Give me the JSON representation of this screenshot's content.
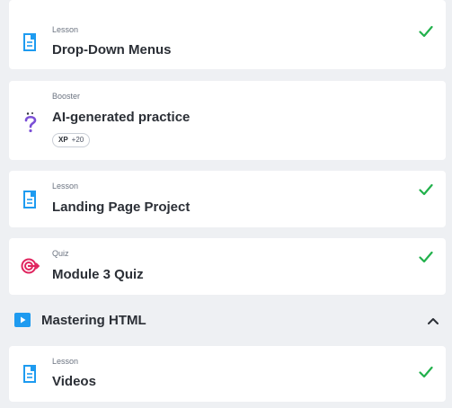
{
  "items": [
    {
      "kind": "Lesson",
      "title": "Drop-Down Menus",
      "completed": true,
      "icon": "lesson-doc-icon"
    },
    {
      "kind": "Booster",
      "title": "AI-generated practice",
      "completed": false,
      "icon": "question-sparkle-icon",
      "xp": {
        "label": "XP",
        "value": "+20"
      }
    },
    {
      "kind": "Lesson",
      "title": "Landing Page Project",
      "completed": true,
      "icon": "lesson-doc-icon"
    },
    {
      "kind": "Quiz",
      "title": "Module 3 Quiz",
      "completed": true,
      "icon": "target-icon"
    }
  ],
  "section": {
    "title": "Mastering HTML",
    "icon": "play-icon",
    "expanded": true
  },
  "section_items": [
    {
      "kind": "Lesson",
      "title": "Videos",
      "completed": true,
      "icon": "lesson-doc-icon"
    }
  ],
  "colors": {
    "accent_blue": "#1e9bf0",
    "check_green": "#22b14c",
    "quiz_red": "#e0245e",
    "booster_purple": "#7b4fd6",
    "background": "#eef0f3"
  }
}
